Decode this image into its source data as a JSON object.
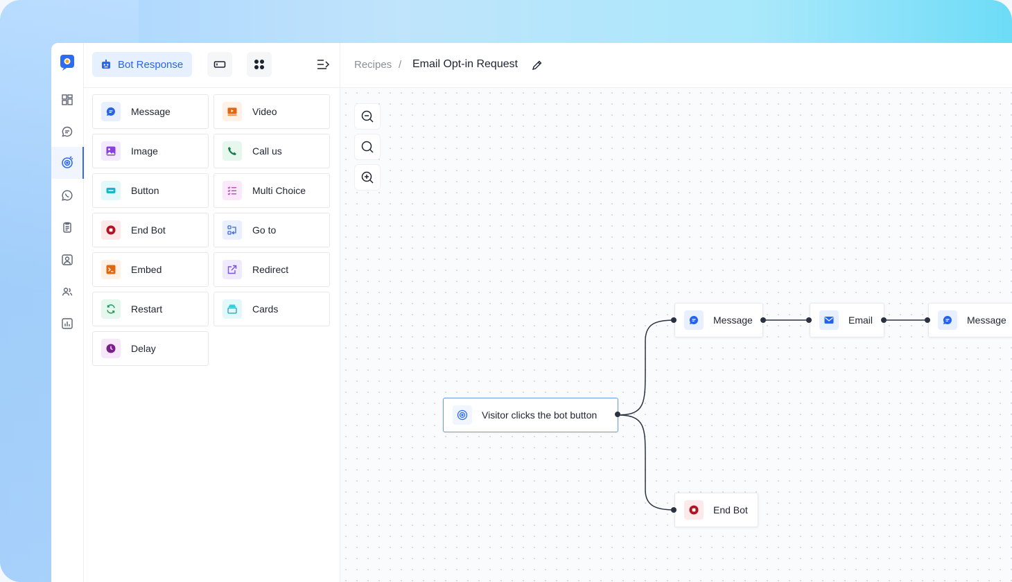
{
  "sidebar_panel": {
    "active_tab": "Bot Response",
    "blocks": [
      {
        "label": "Message",
        "icon": "message-icon",
        "color": "#2563eb",
        "bg": "#e8efff"
      },
      {
        "label": "Video",
        "icon": "video-icon",
        "color": "#e2660f",
        "bg": "#fff1e5"
      },
      {
        "label": "Image",
        "icon": "image-icon",
        "color": "#8b3fe0",
        "bg": "#f3eaff"
      },
      {
        "label": "Call us",
        "icon": "phone-icon",
        "color": "#1a7f4b",
        "bg": "#e6f7ee"
      },
      {
        "label": "Button",
        "icon": "button-icon",
        "color": "#14b8c8",
        "bg": "#e3f8fa"
      },
      {
        "label": "Multi Choice",
        "icon": "list-check-icon",
        "color": "#c43ac9",
        "bg": "#fbe9fb"
      },
      {
        "label": "End Bot",
        "icon": "stop-icon",
        "color": "#b0121f",
        "bg": "#fde8ea"
      },
      {
        "label": "Go to",
        "icon": "goto-icon",
        "color": "#3b6bd8",
        "bg": "#eaf0ff"
      },
      {
        "label": "Embed",
        "icon": "embed-icon",
        "color": "#e2660f",
        "bg": "#fff1e5"
      },
      {
        "label": "Redirect",
        "icon": "redirect-icon",
        "color": "#7b52e0",
        "bg": "#f0eaff"
      },
      {
        "label": "Restart",
        "icon": "restart-icon",
        "color": "#1a9a5c",
        "bg": "#e6f7ee"
      },
      {
        "label": "Cards",
        "icon": "cards-icon",
        "color": "#14a6b8",
        "bg": "#e3f8fa"
      },
      {
        "label": "Delay",
        "icon": "clock-icon",
        "color": "#7a1e8c",
        "bg": "#f6e8fa"
      }
    ]
  },
  "breadcrumb": {
    "parent": "Recipes",
    "separator": "/",
    "title": "Email Opt-in Request"
  },
  "flow": {
    "trigger": "Visitor clicks the bot button",
    "nodes": {
      "message1": "Message",
      "email": "Email",
      "message2": "Message",
      "endbot": "End Bot"
    }
  },
  "colors": {
    "accent": "#2b65e9",
    "connector": "#2a3140"
  }
}
